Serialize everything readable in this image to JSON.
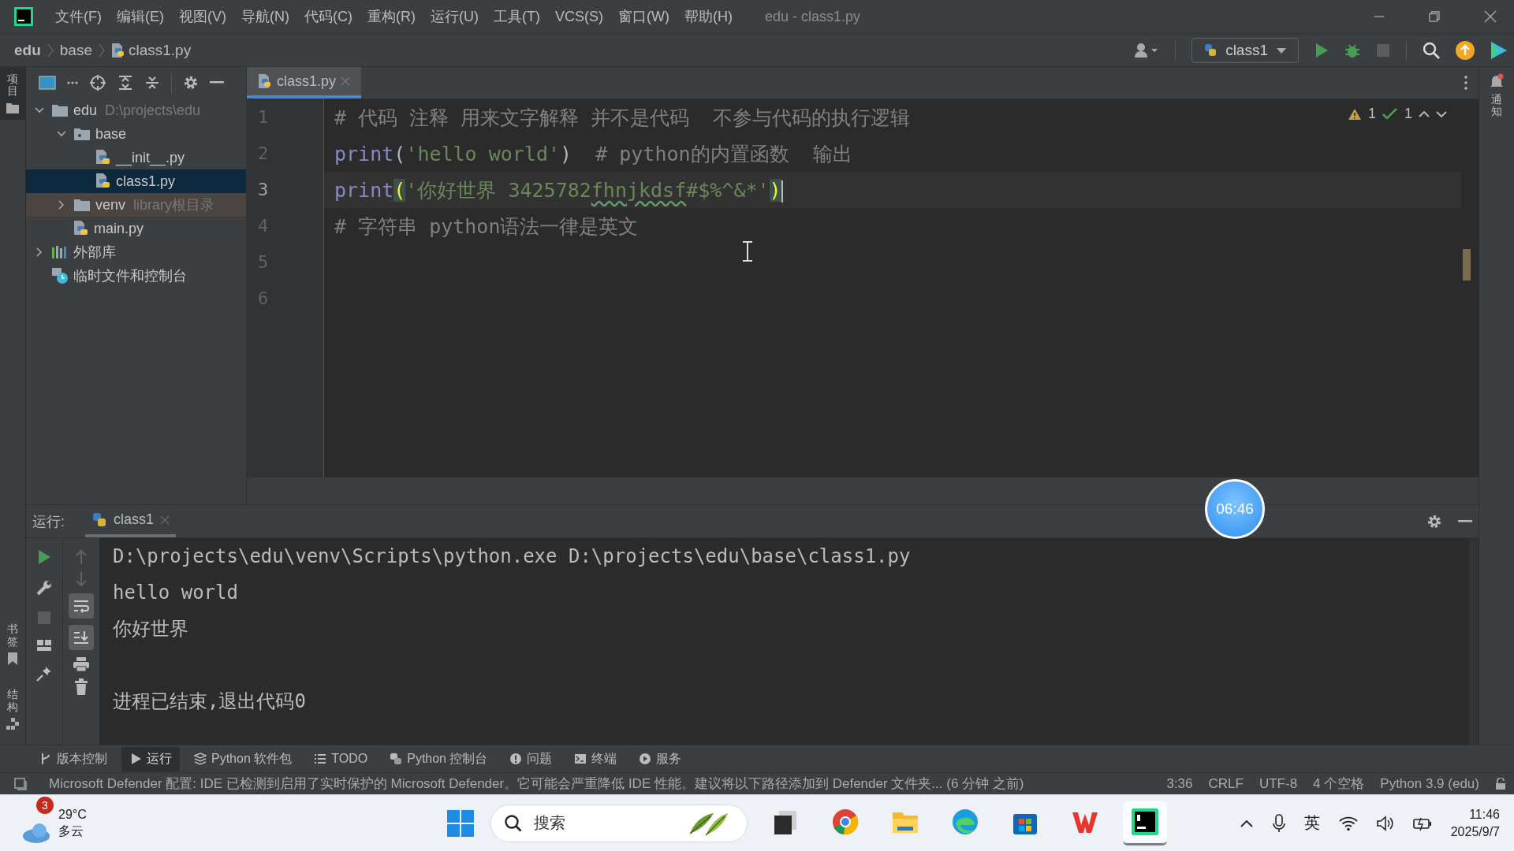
{
  "window": {
    "title": "edu - class1.py",
    "menu": [
      "文件(F)",
      "编辑(E)",
      "视图(V)",
      "导航(N)",
      "代码(C)",
      "重构(R)",
      "运行(U)",
      "工具(T)",
      "VCS(S)",
      "窗口(W)",
      "帮助(H)"
    ]
  },
  "breadcrumb": [
    {
      "label": "edu",
      "kind": "project"
    },
    {
      "label": "base",
      "kind": "folder"
    },
    {
      "label": "class1.py",
      "kind": "file"
    }
  ],
  "run_config": {
    "label": "class1"
  },
  "side_tabs": {
    "left_top": "项目",
    "left_bottom": [
      "书签",
      "结构"
    ],
    "right": "通知"
  },
  "project_tree": [
    {
      "name": "edu",
      "hint": "D:\\projects\\edu",
      "kind": "folder",
      "expanded": true,
      "selected": false,
      "children": [
        {
          "name": "base",
          "kind": "package",
          "expanded": true,
          "selected": false,
          "children": [
            {
              "name": "__init__.py",
              "kind": "python",
              "selected": false
            },
            {
              "name": "class1.py",
              "kind": "python",
              "selected": true
            }
          ]
        },
        {
          "name": "venv",
          "hint": "library根目录",
          "kind": "excluded",
          "expanded": false,
          "selected": false
        },
        {
          "name": "main.py",
          "kind": "python",
          "selected": false
        }
      ]
    },
    {
      "name": "外部库",
      "kind": "library",
      "expanded": false,
      "selected": false
    },
    {
      "name": "临时文件和控制台",
      "kind": "scratch",
      "selected": false
    }
  ],
  "editor": {
    "tabs": [
      {
        "label": "class1.py",
        "selected": true
      }
    ],
    "warnings": "1",
    "checks": "1",
    "lines": [
      {
        "number": "1",
        "current": false,
        "tokens": [
          {
            "kind": "comment",
            "text": "# 代码 注释 用来文字解释 并不是代码  不参与代码的执行逻辑"
          }
        ]
      },
      {
        "number": "2",
        "current": false,
        "tokens": [
          {
            "kind": "builtin",
            "text": "print"
          },
          {
            "kind": "plain",
            "text": "("
          },
          {
            "kind": "string",
            "text": "'hello world'"
          },
          {
            "kind": "plain",
            "text": ")"
          },
          {
            "kind": "comment",
            "text": "  # python的内置函数  输出"
          }
        ]
      },
      {
        "number": "3",
        "current": true,
        "tokens": [
          {
            "kind": "builtin",
            "text": "print"
          },
          {
            "kind": "brace-match",
            "text": "("
          },
          {
            "kind": "string",
            "text": "'你好世界 3425782"
          },
          {
            "kind": "typo",
            "text": "fhnjkdsf"
          },
          {
            "kind": "string",
            "text": "#$%^&*'"
          },
          {
            "kind": "brace-match",
            "text": ")"
          }
        ]
      },
      {
        "number": "4",
        "current": false,
        "tokens": [
          {
            "kind": "comment",
            "text": "# 字符串 python语法一律是英文"
          }
        ]
      },
      {
        "number": "5",
        "current": false
      },
      {
        "number": "6",
        "current": false
      }
    ]
  },
  "run_panel": {
    "title": "运行:",
    "tabs": [
      {
        "label": "class1",
        "selected": true
      }
    ],
    "output": [
      "D:\\projects\\edu\\venv\\Scripts\\python.exe D:\\projects\\edu\\base\\class1.py",
      "hello world",
      "你好世界"
    ],
    "exit_message": "进程已结束,退出代码0"
  },
  "timer": "06:46",
  "tool_tabs": [
    {
      "label": "版本控制",
      "kind": "vcs",
      "selected": false
    },
    {
      "label": "运行",
      "kind": "run",
      "selected": true
    },
    {
      "label": "Python 软件包",
      "kind": "packages",
      "selected": false
    },
    {
      "label": "TODO",
      "kind": "todo",
      "selected": false
    },
    {
      "label": "Python 控制台",
      "kind": "python",
      "selected": false
    },
    {
      "label": "问题",
      "kind": "problems",
      "selected": false
    },
    {
      "label": "终端",
      "kind": "terminal",
      "selected": false
    },
    {
      "label": "服务",
      "kind": "services",
      "selected": false
    }
  ],
  "status_bar": {
    "message": "Microsoft Defender 配置: IDE 已检测到启用了实时保护的 Microsoft Defender。它可能会严重降低 IDE 性能。建议将以下路径添加到 Defender 文件夹... (6 分钟 之前)",
    "items": [
      "3:36",
      "CRLF",
      "UTF-8",
      "4 个空格",
      "Python 3.9 (edu)"
    ]
  },
  "taskbar": {
    "weather": {
      "badge": "3",
      "temperature": "29°C",
      "condition": "多云"
    },
    "search": {
      "placeholder": "搜索"
    },
    "apps": [
      {
        "kind": "notes",
        "active": false
      },
      {
        "kind": "chrome",
        "active": false
      },
      {
        "kind": "folder",
        "active": false
      },
      {
        "kind": "edge",
        "active": false
      },
      {
        "kind": "store",
        "active": false
      },
      {
        "kind": "wps",
        "active": false
      },
      {
        "kind": "pycharm",
        "active": true
      }
    ],
    "ime": "英",
    "time": "11:46",
    "date": "2025/9/7"
  }
}
